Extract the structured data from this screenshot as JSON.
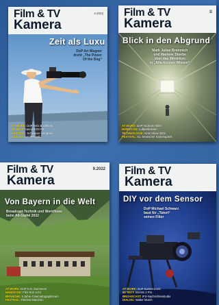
{
  "covers": [
    {
      "logo_line1": "Film & TV",
      "logo_line2": "Kamera",
      "issue_small": "4.2022",
      "issue_big": "",
      "headline": "Zeit als Luxus",
      "kicker": [
        "DoP Ari Wegner",
        "dreht „The Power",
        "Of the Dog“"
      ],
      "toc": [
        {
          "label": "AT WORK:",
          "text": "DoP Felix Buchheim"
        },
        {
          "label": "IM TEST:",
          "text": "Canon EOS R5"
        },
        {
          "label": "FESTIVAL:",
          "text": "Schweizer Filmpreis"
        },
        {
          "label": "DIALOG:",
          "text": "SATFProjekt"
        }
      ]
    },
    {
      "logo_line1": "Film & TV",
      "logo_line2": "Kamera",
      "issue_small": "",
      "issue_big": "S",
      "headline": "Blick in den Abgrund",
      "kicker": [
        "Mark Julian Brehmich",
        "und Marlene Stoebe",
        "über das Mitwirken",
        "in „Alfa-Kenner-Wissen“"
      ],
      "toc": [
        {
          "label": "AT WORK:",
          "text": "DoP Andreas Höfer"
        },
        {
          "label": "HANDS-ON:",
          "text": "Luftperkeleien"
        },
        {
          "label": "TECHNOLOGIE:",
          "text": "NAB Show 2022"
        },
        {
          "label": "FESTIVAL:",
          "text": "51. Deutscher Kamerapreis"
        }
      ]
    },
    {
      "logo_line1": "Film & TV",
      "logo_line2": "Kamera",
      "issue_small": "",
      "issue_big": "9.2022",
      "headline": "Von Bayern in die Welt",
      "kicker": [
        "Broadcast-Technik und Workflows",
        "beim Alt-Gipfel 2022"
      ],
      "toc": [
        {
          "label": "AT WORK:",
          "text": "DoP N.N. Summerer"
        },
        {
          "label": "HANDS-ON:",
          "text": "Film Noir Licht"
        },
        {
          "label": "BRANCHE:",
          "text": "5 Jahre Cinematographinnen"
        },
        {
          "label": "FESTIVAL:",
          "text": "Filmfest München"
        }
      ]
    },
    {
      "logo_line1": "Film & TV",
      "logo_line2": "Kamera",
      "issue_small": "",
      "issue_big": "",
      "headline": "DIY vor dem Sensor",
      "kicker": [
        "DoP Michael Schwarz",
        "baut für „Tatort“",
        "seinen Filter"
      ],
      "toc": [
        {
          "label": "AT WORK:",
          "text": "DoP Kamen Lovic"
        },
        {
          "label": "IM TEST:",
          "text": "XM-M1 2 Pro"
        },
        {
          "label": "BROADCAST:",
          "text": "IFS-Nachrichtenstudio"
        },
        {
          "label": "DIALOG:",
          "text": "Walter Murch"
        }
      ]
    }
  ]
}
